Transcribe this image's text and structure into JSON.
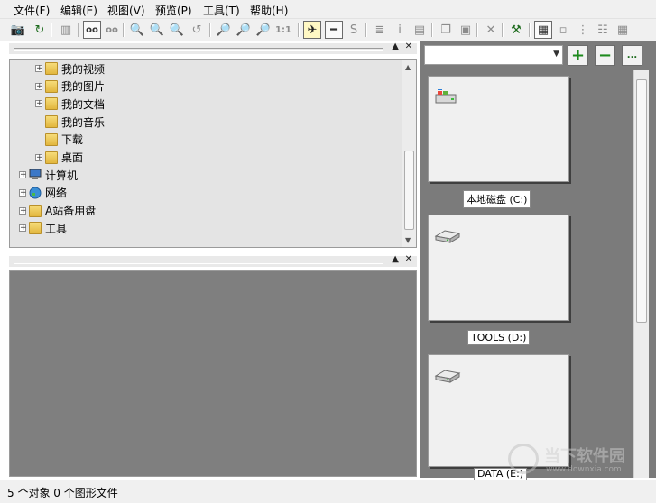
{
  "menu": {
    "items": [
      "文件(F)",
      "编辑(E)",
      "视图(V)",
      "预览(P)",
      "工具(T)",
      "帮助(H)"
    ]
  },
  "toolbar": {
    "buttons": [
      {
        "name": "camera-icon",
        "glyph": "📷",
        "state": "disabled"
      },
      {
        "name": "refresh-icon",
        "glyph": "↻",
        "state": "active"
      },
      {
        "name": "filmstrip-icon",
        "glyph": "▥",
        "state": "normal"
      },
      {
        "name": "stereo-view-icon",
        "glyph": "oo",
        "state": "pressed"
      },
      {
        "name": "stereo-view-alt-icon",
        "glyph": "oo",
        "state": "disabled"
      },
      {
        "name": "zoom-out-icon",
        "glyph": "🔍",
        "state": "disabled"
      },
      {
        "name": "zoom-in-icon",
        "glyph": "🔍",
        "state": "disabled"
      },
      {
        "name": "zoom-fit-icon",
        "glyph": "🔍",
        "state": "disabled"
      },
      {
        "name": "zoom-rotate-icon",
        "glyph": "↺",
        "state": "disabled"
      },
      {
        "name": "zoom-window-icon",
        "glyph": "🔎",
        "state": "disabled"
      },
      {
        "name": "zoom-plus-icon",
        "glyph": "🔎",
        "state": "disabled"
      },
      {
        "name": "zoom-minus-icon",
        "glyph": "🔎",
        "state": "disabled"
      },
      {
        "name": "actual-size-icon",
        "glyph": "1:1",
        "state": "disabled"
      },
      {
        "name": "run-icon",
        "glyph": "✈",
        "state": "press-yellow"
      },
      {
        "name": "ruler-icon",
        "glyph": "━",
        "state": "pressed"
      },
      {
        "name": "s-icon",
        "glyph": "S",
        "state": "disabled"
      },
      {
        "name": "stack-icon",
        "glyph": "≣",
        "state": "disabled"
      },
      {
        "name": "info-icon",
        "glyph": "i",
        "state": "disabled"
      },
      {
        "name": "document-icon",
        "glyph": "▤",
        "state": "disabled"
      },
      {
        "name": "copy-icon",
        "glyph": "❐",
        "state": "disabled"
      },
      {
        "name": "paste-icon",
        "glyph": "▣",
        "state": "disabled"
      },
      {
        "name": "delete-icon",
        "glyph": "✕",
        "state": "disabled"
      },
      {
        "name": "tools-icon",
        "glyph": "⚒",
        "state": "active"
      },
      {
        "name": "thumbnails-view-icon",
        "glyph": "▦",
        "state": "pressed"
      },
      {
        "name": "large-icons-view-icon",
        "glyph": "▫",
        "state": "normal"
      },
      {
        "name": "tree-view-icon",
        "glyph": "⋮",
        "state": "normal"
      },
      {
        "name": "list-view-icon",
        "glyph": "☷",
        "state": "normal"
      },
      {
        "name": "details-view-icon",
        "glyph": "▦",
        "state": "normal"
      }
    ]
  },
  "tree": {
    "items": [
      {
        "label": "我的视频",
        "level": 2,
        "expander": "+",
        "icon": "video-folder-icon"
      },
      {
        "label": "我的图片",
        "level": 2,
        "expander": "+",
        "icon": "pictures-folder-icon"
      },
      {
        "label": "我的文档",
        "level": 2,
        "expander": "+",
        "icon": "documents-folder-icon"
      },
      {
        "label": "我的音乐",
        "level": 2,
        "expander": "",
        "icon": "music-folder-icon"
      },
      {
        "label": "下载",
        "level": 2,
        "expander": "",
        "icon": "downloads-folder-icon"
      },
      {
        "label": "桌面",
        "level": 2,
        "expander": "+",
        "icon": "desktop-folder-icon"
      },
      {
        "label": "计算机",
        "level": 1,
        "expander": "+",
        "icon": "computer-icon"
      },
      {
        "label": "网络",
        "level": 1,
        "expander": "+",
        "icon": "network-icon"
      },
      {
        "label": "A站备用盘",
        "level": 1,
        "expander": "+",
        "icon": "folder-icon"
      },
      {
        "label": "工具",
        "level": 1,
        "expander": "+",
        "icon": "folder-icon"
      }
    ]
  },
  "right": {
    "path_value": "",
    "add_glyph": "+",
    "remove_glyph": "−",
    "more_glyph": "..."
  },
  "thumbnails": [
    {
      "caption": "本地磁盘 (C:)",
      "icon": "windows-drive-icon"
    },
    {
      "caption": "TOOLS (D:)",
      "icon": "hard-drive-icon"
    },
    {
      "caption": "DATA (E:)",
      "icon": "hard-drive-icon"
    }
  ],
  "status": {
    "text": "5 个对象 0 个图形文件"
  },
  "watermark": {
    "text": "当下软件园",
    "sub": "www.downxia.com"
  },
  "colors": {
    "panel_gray": "#7b7b7b",
    "tree_bg": "#e4e4e4",
    "accent_green": "#1d8a1d"
  }
}
